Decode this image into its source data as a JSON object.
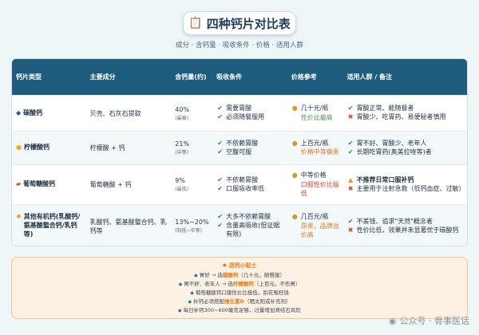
{
  "title": "四种钙片对比表",
  "title_icon": "clipboard-icon",
  "subtitle": "成分 · 含钙量 · 吸收条件 · 价格 · 适用人群",
  "columns": [
    "钙片类型",
    "主要成分",
    "含钙量(约)",
    "吸收条件",
    "价格参考",
    "适用人群 / 备注"
  ],
  "rows": [
    {
      "icon": "diamond-icon",
      "name": "碳酸钙",
      "ingredient": "贝壳、石灰石提取",
      "content": "40%",
      "content_note": "(最高)",
      "absorb": [
        {
          "mark": "check",
          "text": "需要胃酸"
        },
        {
          "mark": "check",
          "text": "必须随餐服用"
        }
      ],
      "price": "几十元/瓶",
      "price_note": "性价比最高",
      "notes": [
        {
          "mark": "check",
          "text": "胃酸正常、能随餐者"
        },
        {
          "mark": "cross",
          "text": "胃酸少、吃胃药、易便秘者慎用"
        }
      ]
    },
    {
      "icon": "lemon-icon",
      "name": "柠檬酸钙",
      "ingredient": "柠檬酸 + 钙",
      "content": "21%",
      "content_note": "(中等)",
      "absorb": [
        {
          "mark": "check",
          "text": "不依赖胃酸"
        },
        {
          "mark": "check",
          "text": "空腹可服"
        }
      ],
      "price": "上百元/瓶",
      "price_note": "价格中等偏贵",
      "notes": [
        {
          "mark": "check",
          "text": "胃不好、胃酸少、老年人"
        },
        {
          "mark": "check",
          "text": "长期吃胃药(奥美拉唑等)者"
        }
      ]
    },
    {
      "icon": "pill-icon",
      "name": "葡萄糖酸钙",
      "ingredient": "葡萄糖酸 + 钙",
      "content": "9%",
      "content_note": "(最低)",
      "absorb": [
        {
          "mark": "check",
          "text": "不依赖胃酸"
        },
        {
          "mark": "check",
          "text": "口服吸收率低"
        }
      ],
      "price": "中等价格",
      "price_note": "口服性价比极低",
      "notes": [
        {
          "mark": "warn",
          "text": "不推荐日常口服补钙"
        },
        {
          "mark": "cross",
          "text": "主要用于注射急救（低钙血症、过敏）"
        }
      ]
    },
    {
      "icon": "sparkle-icon",
      "name": "其他有机钙(乳酸钙/氨基酸螯合钙/乳钙等)",
      "ingredient": "乳酸钙、氨基酸螯合钙、乳钙等",
      "content": "13%~20%",
      "content_note": "(较低~中等)",
      "absorb": [
        {
          "mark": "check",
          "text": "大多不依赖胃酸"
        },
        {
          "mark": "check",
          "text": "含量高吸收(但证据有限)"
        }
      ],
      "price": "几百元/瓶",
      "price_note": "昂贵，品牌溢价高",
      "notes": [
        {
          "mark": "check",
          "text": "不差钱、追求\"天然\"概念者"
        },
        {
          "mark": "cross",
          "text": "性价比低，效果并未显著优于碳酸钙"
        }
      ]
    }
  ],
  "tips": {
    "icon": "bulb-icon",
    "title": "选钙小贴士",
    "lines": [
      {
        "pre": "胃好 → 选",
        "hl": "碳酸钙",
        "post": "（几十元，随餐服）"
      },
      {
        "pre": "胃不好、老年人 → 选",
        "hl": "柠檬酸钙",
        "post": "（上百元，不伤胃）"
      },
      {
        "pre": "葡萄糖酸钙口服性价比极低，别花冤枉钱",
        "hl": "",
        "post": ""
      },
      {
        "pre": "补钙必须搭配",
        "hl": "维生素D",
        "post": "（晒太阳或补充剂）"
      },
      {
        "pre": "每日补钙300~600毫克足够，过量增加肾结石风险",
        "hl": "",
        "post": ""
      }
    ]
  },
  "watermark": "公众号 · 骨事医话",
  "colors": {
    "header": "#1d5c7c",
    "accent": "#e57c12",
    "check": "#2d8a3e",
    "cross": "#d6452f"
  }
}
